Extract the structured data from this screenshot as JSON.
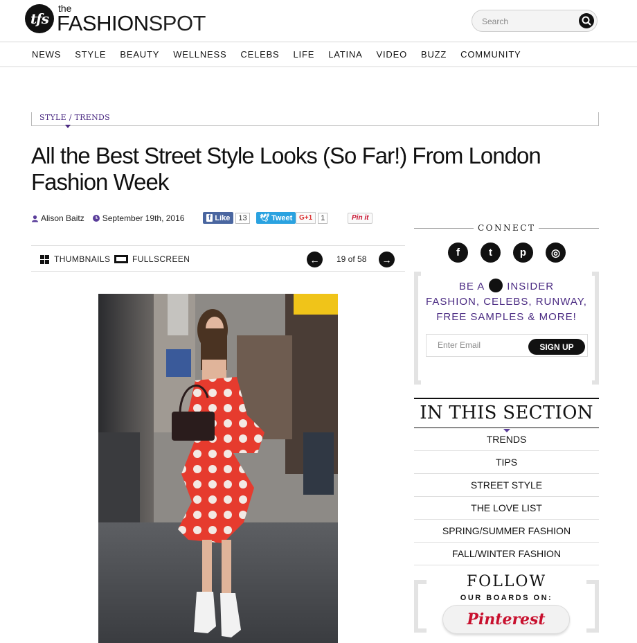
{
  "brand": {
    "the": "the",
    "name_bold": "FASHION",
    "name_light": "SPOT",
    "badge": "tfs"
  },
  "search": {
    "placeholder": "Search"
  },
  "nav": [
    "NEWS",
    "STYLE",
    "BEAUTY",
    "WELLNESS",
    "CELEBS",
    "LIFE",
    "LATINA",
    "VIDEO",
    "BUZZ",
    "COMMUNITY"
  ],
  "breadcrumb": "STYLE / TRENDS",
  "article": {
    "title": "All the Best Street Style Looks (So Far!) From London Fashion Week",
    "author": "Alison Baitz",
    "date": "September 19th, 2016"
  },
  "share": {
    "fb_label": "Like",
    "fb_count": "13",
    "tw_label": "Tweet",
    "gp_label": "G+1",
    "gp_count": "1",
    "pin_label": "Pin it"
  },
  "gallery": {
    "thumbnails": "THUMBNAILS",
    "fullscreen": "FULLSCREEN",
    "counter": "19 of 58",
    "prev": "←",
    "next": "→"
  },
  "sidebar": {
    "connect": "CONNECT",
    "social": [
      {
        "icon": "facebook-icon",
        "glyph": "f"
      },
      {
        "icon": "twitter-icon",
        "glyph": "t"
      },
      {
        "icon": "pinterest-icon",
        "glyph": "p"
      },
      {
        "icon": "instagram-icon",
        "glyph": "◎"
      }
    ],
    "insider": {
      "line1_a": "BE A",
      "line1_b": "INSIDER",
      "line2": "FASHION, CELEBS, RUNWAY,",
      "line3": "FREE SAMPLES & MORE!",
      "email_placeholder": "Enter Email",
      "signup": "SIGN UP"
    },
    "section_title": "IN THIS SECTION",
    "section_links": [
      "TRENDS",
      "TIPS",
      "STREET STYLE",
      "THE LOVE LIST",
      "SPRING/SUMMER FASHION",
      "FALL/WINTER FASHION"
    ],
    "follow_title": "FOLLOW",
    "follow_sub": "OUR BOARDS ON:",
    "pinterest_label": "Pinterest"
  },
  "colors": {
    "accent": "#4a2a82",
    "facebook": "#4a66a0",
    "twitter": "#2aa2e0",
    "pinterest": "#c8102e"
  }
}
